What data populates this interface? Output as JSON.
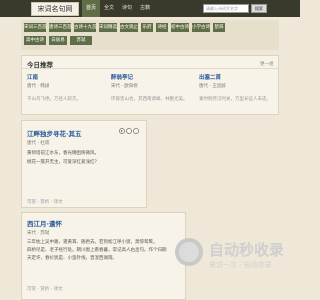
{
  "header": {
    "logo": "宋词名句网",
    "nav": [
      "首页",
      "全文",
      "诗句",
      "古籍"
    ],
    "search_placeholder": "请输入诗词文名字",
    "search_button": "搜索"
  },
  "tags": [
    "宋词三百首",
    "唐诗三百首",
    "古诗十九首",
    "宋词精选",
    "古文观止",
    "乐府",
    "诗经",
    "初中古诗",
    "小学古诗",
    "楚辞",
    "高中古诗",
    "白居易",
    "苏轼"
  ],
  "recommend": {
    "title": "今日推荐",
    "more": "更一组",
    "items": [
      {
        "title": "江南",
        "meta": "唐代 · 韩翃",
        "line": "千山鸟飞绝，万径人踪灭。"
      },
      {
        "title": "醉翁亭记",
        "meta": "宋代 · 欧阳修",
        "line": "环滁皆山也，其西南诸峰，林壑尤美。"
      },
      {
        "title": "出塞二首",
        "meta": "唐代 · 王昌龄",
        "line": "秦时明月汉时关，万里长征人未还。"
      }
    ]
  },
  "cards": [
    {
      "title": "江畔独步寻花·其五",
      "meta": "唐代 · 杜甫",
      "lines": [
        "黄师塔前江水东，春光懒困倚微风。",
        "桃花一簇开无主，可爱深红爱浅红？"
      ],
      "foot": "可赏 · 赏析 · 译文"
    },
    {
      "title": "西江月·遣怀",
      "meta": "宋代 · 苏轼",
      "lines": [
        "三年枕上吴中路，遣黄耳、随君去。若到松江呼小渡，莫惊鸳鹭，",
        "四桥尽是、老子经行处。辋川图上看春暮，常记高人右丞句。作个归期",
        "天定许，春衫犹是、小蛮针线，曾湿西湖雨。"
      ],
      "foot": "可赏 · 赏析 · 译文"
    }
  ],
  "watermark": {
    "text": "自动秒收录",
    "sub": "来访一次 · 自动收录"
  }
}
